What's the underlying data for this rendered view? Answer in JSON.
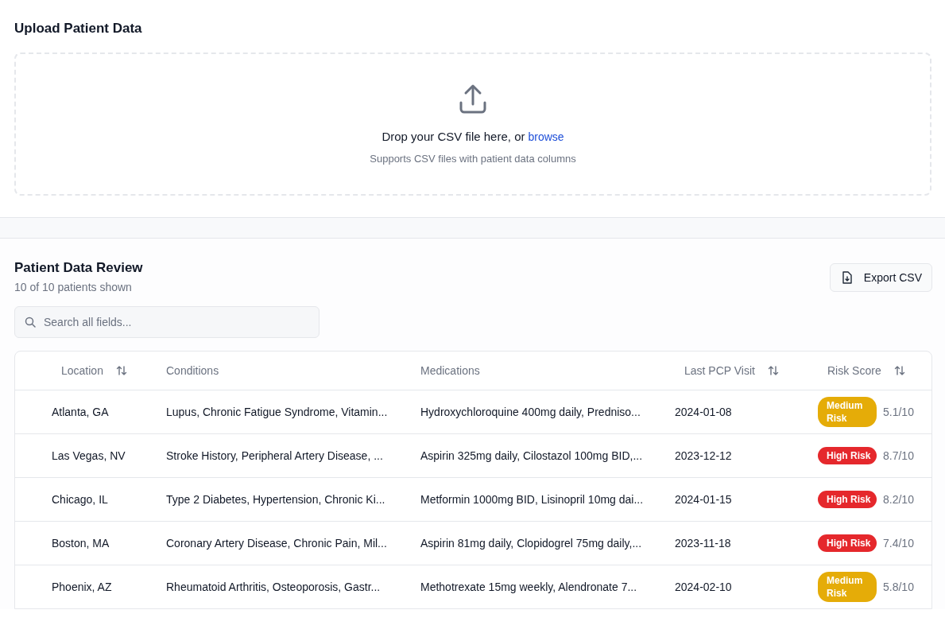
{
  "upload": {
    "title": "Upload Patient Data",
    "prompt": "Drop your CSV file here, or",
    "browse_link": "browse",
    "hint": "Supports CSV files with patient data columns"
  },
  "review": {
    "title": "Patient Data Review",
    "count": "10 of 10 patients shown",
    "export_button": "Export CSV",
    "search": {
      "placeholder": "Search all fields..."
    }
  },
  "table": {
    "columns": [
      {
        "label": "Location",
        "sortable": true
      },
      {
        "label": "Conditions",
        "sortable": false
      },
      {
        "label": "Medications",
        "sortable": false
      },
      {
        "label": "Last PCP Visit",
        "sortable": true
      },
      {
        "label": "Risk Score",
        "sortable": true
      }
    ],
    "rows": [
      {
        "location": "Atlanta, GA",
        "conditions": "Lupus, Chronic Fatigue Syndrome, Vitamin...",
        "medications": "Hydroxychloroquine 400mg daily, Predniso...",
        "last_visit": "2024-01-08",
        "risk": {
          "kind": "medium",
          "label": "Medium Risk",
          "score": "5.1/10"
        }
      },
      {
        "location": "Las Vegas, NV",
        "conditions": "Stroke History, Peripheral Artery Disease, ...",
        "medications": "Aspirin 325mg daily, Cilostazol 100mg BID,...",
        "last_visit": "2023-12-12",
        "risk": {
          "kind": "high",
          "label": "High Risk",
          "score": "8.7/10"
        }
      },
      {
        "location": "Chicago, IL",
        "conditions": "Type 2 Diabetes, Hypertension, Chronic Ki...",
        "medications": "Metformin 1000mg BID, Lisinopril 10mg dai...",
        "last_visit": "2024-01-15",
        "risk": {
          "kind": "high",
          "label": "High Risk",
          "score": "8.2/10"
        }
      },
      {
        "location": "Boston, MA",
        "conditions": "Coronary Artery Disease, Chronic Pain, Mil...",
        "medications": "Aspirin 81mg daily, Clopidogrel 75mg daily,...",
        "last_visit": "2023-11-18",
        "risk": {
          "kind": "high",
          "label": "High Risk",
          "score": "7.4/10"
        }
      },
      {
        "location": "Phoenix, AZ",
        "conditions": "Rheumatoid Arthritis, Osteoporosis, Gastr...",
        "medications": "Methotrexate 15mg weekly, Alendronate 7...",
        "last_visit": "2024-02-10",
        "risk": {
          "kind": "medium",
          "label": "Medium Risk",
          "score": "5.8/10"
        }
      }
    ]
  }
}
